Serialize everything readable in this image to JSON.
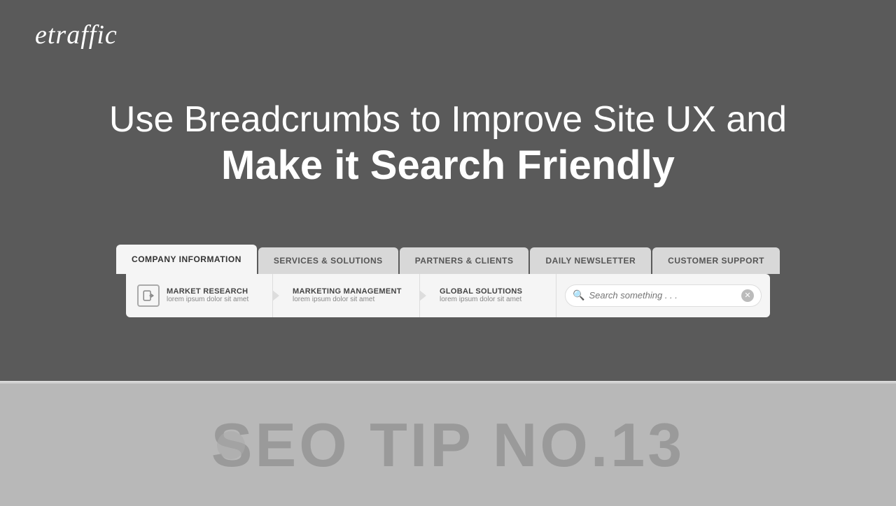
{
  "logo": {
    "text": "etraffic"
  },
  "headline": {
    "line1": "Use Breadcrumbs to Improve Site UX and",
    "line2": "Make it Search Friendly"
  },
  "nav_tabs": [
    {
      "id": "company-info",
      "label": "COMPANY INFORMATION",
      "active": true
    },
    {
      "id": "services-solutions",
      "label": "SERVICES & SOLUTIONS",
      "active": false
    },
    {
      "id": "partners-clients",
      "label": "PARTNERS & CLIENTS",
      "active": false
    },
    {
      "id": "daily-newsletter",
      "label": "DAILY NEWSLETTER",
      "active": false
    },
    {
      "id": "customer-support",
      "label": "CUSTOMER SUPPORT",
      "active": false
    }
  ],
  "submenu_items": [
    {
      "id": "market-research",
      "title": "MARKET RESEARCH",
      "subtitle": "lorem ipsum dolor sit amet",
      "has_icon": true
    },
    {
      "id": "marketing-management",
      "title": "MARKETING MANAGEMENT",
      "subtitle": "lorem ipsum dolor sit amet",
      "has_icon": false
    },
    {
      "id": "global-solutions",
      "title": "GLOBAL SOLUTIONS",
      "subtitle": "lorem ipsum dolor sit amet",
      "has_icon": false
    }
  ],
  "search": {
    "placeholder": "Search something . . .",
    "value": ""
  },
  "seo_tip": {
    "text": "SEO TIP NO.13"
  }
}
